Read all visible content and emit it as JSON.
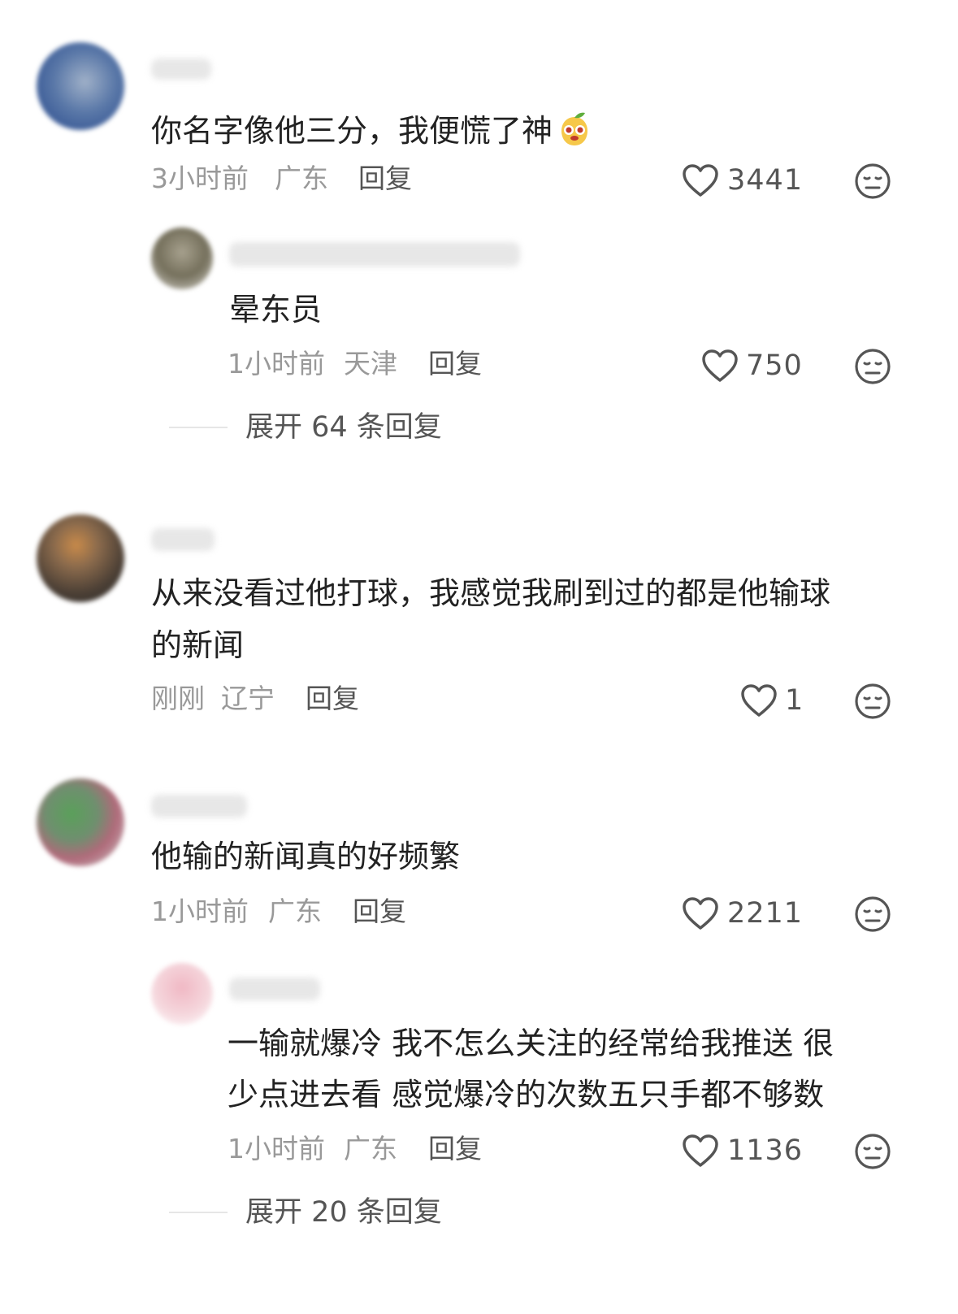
{
  "comments": [
    {
      "text": "你名字像他三分，我便慌了神",
      "time": "3小时前",
      "location": "广东",
      "reply_label": "回复",
      "likes": "3441",
      "replies": [
        {
          "text": "晕东员",
          "time": "1小时前",
          "location": "天津",
          "reply_label": "回复",
          "likes": "750"
        }
      ],
      "expand_label": "展开 64 条回复"
    },
    {
      "text_line1": "从来没看过他打球，我感觉我刷到过的都是他输球",
      "text_line2": "的新闻",
      "time": "刚刚",
      "location": "辽宁",
      "reply_label": "回复",
      "likes": "1"
    },
    {
      "text": "他输的新闻真的好频繁",
      "time": "1小时前",
      "location": "广东",
      "reply_label": "回复",
      "likes": "2211",
      "replies": [
        {
          "text_line1": "一输就爆冷 我不怎么关注的经常给我推送 很",
          "text_line2": "少点进去看 感觉爆冷的次数五只手都不够数",
          "time": "1小时前",
          "location": "广东",
          "reply_label": "回复",
          "likes": "1136"
        }
      ],
      "expand_label": "展开 20 条回复"
    }
  ],
  "icons": {
    "like": "heart-outline-icon",
    "dislike": "meh-face-icon",
    "emoji": "mango-emoji-icon"
  },
  "colors": {
    "text": "#222222",
    "meta": "#999999",
    "icon": "#555555"
  }
}
